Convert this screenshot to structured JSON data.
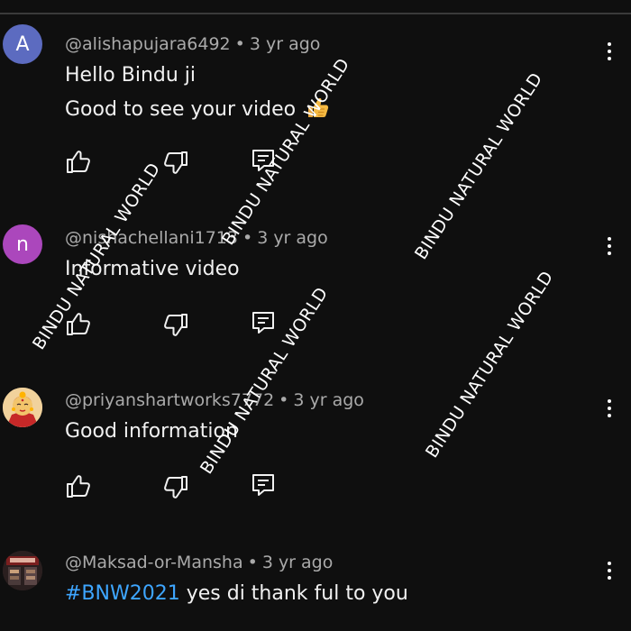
{
  "comments": [
    {
      "avatar_letter": "A",
      "avatar_color": "#5c6bc0",
      "handle": "@alishapujara6492",
      "separator": "•",
      "time": "3 yr ago",
      "lines": [
        "Hello Bindu ji",
        "Good to see your video"
      ],
      "emoji": "thumbs-up-emoji"
    },
    {
      "avatar_letter": "n",
      "avatar_color": "#ab47bc",
      "handle": "@nishachellani1713",
      "separator": "•",
      "time": "3 yr ago",
      "lines": [
        "Informative video"
      ]
    },
    {
      "avatar_image": "goddess-illustration",
      "handle": "@priyanshartworks7772",
      "separator": "•",
      "time": "3 yr ago",
      "lines": [
        "Good information"
      ]
    },
    {
      "avatar_image": "shop-photo",
      "handle": "@Maksad-or-Mansha",
      "separator": "•",
      "time": "3 yr ago",
      "hashtag": "#BNW2021",
      "text_after_hashtag": " yes di thank ful to you"
    }
  ],
  "icons": {
    "like": "thumbs-up-outline-icon",
    "dislike": "thumbs-down-outline-icon",
    "reply": "reply-comment-icon",
    "more": "vertical-ellipsis-icon"
  },
  "watermark_text": "BINDU NATURAL WORLD",
  "colors": {
    "background": "#0f0f0f",
    "text": "#f1f1f1",
    "meta": "#aaaaaa",
    "hashtag": "#3ea6ff"
  }
}
